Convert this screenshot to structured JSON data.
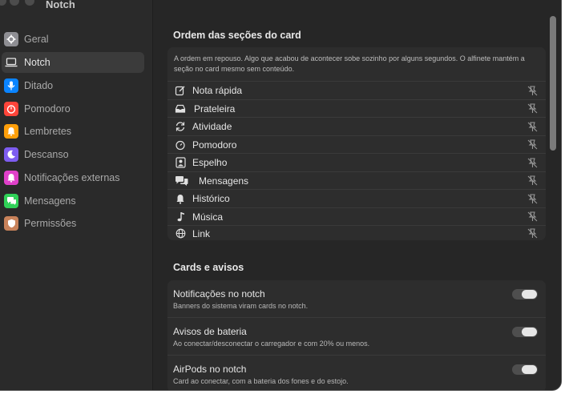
{
  "window": {
    "title": "Notch"
  },
  "sidebar": {
    "items": [
      {
        "label": "Geral",
        "icon": "gear-icon",
        "color": "#8e8e93"
      },
      {
        "label": "Notch",
        "icon": "laptop-icon",
        "color": "#3a3a3a",
        "active": true
      },
      {
        "label": "Ditado",
        "icon": "microphone-icon",
        "color": "#0a84ff"
      },
      {
        "label": "Pomodoro",
        "icon": "timer-icon",
        "color": "#ff453a"
      },
      {
        "label": "Lembretes",
        "icon": "bell-icon",
        "color": "#ff9f0a"
      },
      {
        "label": "Descanso",
        "icon": "moon-icon",
        "color": "#7d5cf0"
      },
      {
        "label": "Notificações externas",
        "icon": "bell-badge-icon",
        "color": "#e040c9"
      },
      {
        "label": "Mensagens",
        "icon": "chat-icon",
        "color": "#30d158"
      },
      {
        "label": "Permissões",
        "icon": "shield-icon",
        "color": "#c8825a"
      }
    ]
  },
  "order_section": {
    "title": "Ordem das seções do card",
    "description": "A ordem em repouso. Algo que acabou de acontecer sobe sozinho por alguns segundos. O alfinete mantém a seção no card mesmo sem conteúdo.",
    "items": [
      {
        "label": "Nota rápida",
        "icon": "note-edit-icon"
      },
      {
        "label": "Prateleira",
        "icon": "tray-icon"
      },
      {
        "label": "Atividade",
        "icon": "sync-icon"
      },
      {
        "label": "Pomodoro",
        "icon": "timer-icon"
      },
      {
        "label": "Espelho",
        "icon": "person-frame-icon"
      },
      {
        "label": "Mensagens",
        "icon": "chat-bubbles-icon"
      },
      {
        "label": "Histórico",
        "icon": "bell-icon"
      },
      {
        "label": "Música",
        "icon": "music-note-icon"
      },
      {
        "label": "Link",
        "icon": "globe-icon"
      }
    ]
  },
  "cards_section": {
    "title": "Cards e avisos",
    "settings": [
      {
        "title": "Notificações no notch",
        "subtitle": "Banners do sistema viram cards no notch.",
        "on": true
      },
      {
        "title": "Avisos de bateria",
        "subtitle": "Ao conectar/desconectar o carregador e com 20% ou menos.",
        "on": true
      },
      {
        "title": "AirPods no notch",
        "subtitle": "Card ao conectar, com a bateria dos fones e do estojo.",
        "on": true
      }
    ]
  }
}
